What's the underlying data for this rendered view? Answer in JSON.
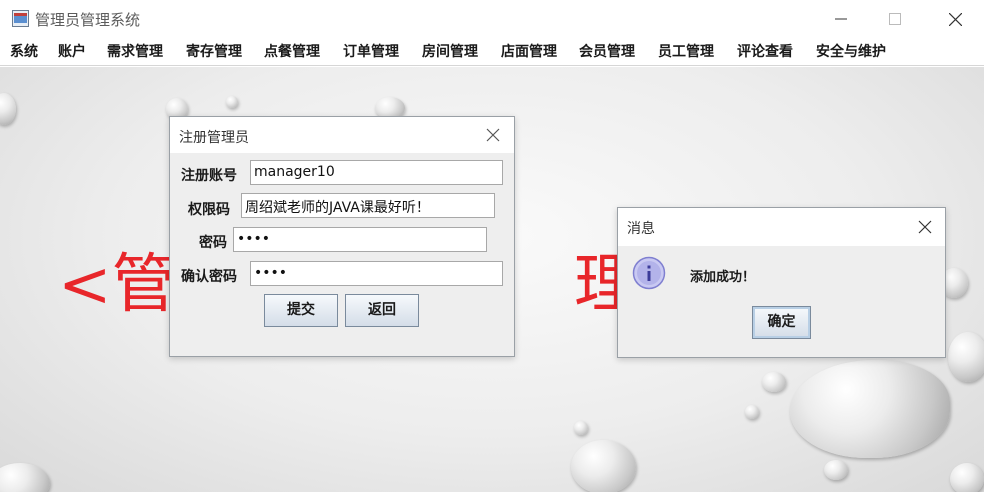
{
  "window": {
    "title": "管理员管理系统"
  },
  "menubar": {
    "items": [
      "系统",
      "账户",
      "需求管理",
      "寄存管理",
      "点餐管理",
      "订单管理",
      "房间管理",
      "店面管理",
      "会员管理",
      "员工管理",
      "评论查看",
      "安全与维护"
    ]
  },
  "background": {
    "big_text_left": "<管",
    "big_text_right": "理"
  },
  "register_dialog": {
    "title": "注册管理员",
    "fields": [
      {
        "label": "注册账号",
        "value": "manager10"
      },
      {
        "label": "权限码",
        "value": "周绍斌老师的JAVA课最好听！"
      },
      {
        "label": "密码",
        "value": "••••"
      },
      {
        "label": "确认密码",
        "value": "••••"
      }
    ],
    "submit_label": "提交",
    "back_label": "返回"
  },
  "message_dialog": {
    "title": "消息",
    "message": "添加成功！",
    "ok_label": "确定",
    "icon": "info-icon"
  },
  "colors": {
    "big_text": "#e8262a",
    "button_border": "#7a8a9c",
    "info_icon": "#8e8ee0"
  }
}
